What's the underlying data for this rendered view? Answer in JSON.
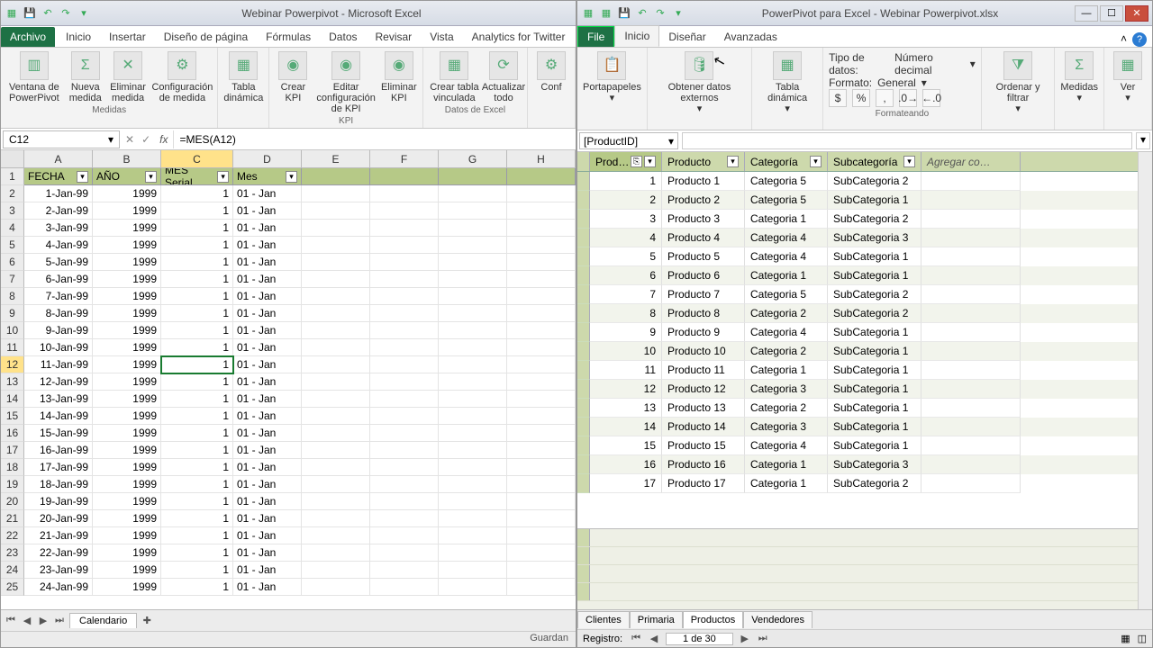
{
  "excel": {
    "title": "Webinar Powerpivot - Microsoft Excel",
    "tabs": {
      "file": "Archivo",
      "items": [
        "Inicio",
        "Insertar",
        "Diseño de página",
        "Fórmulas",
        "Datos",
        "Revisar",
        "Vista",
        "Analytics for Twitter"
      ]
    },
    "ribbon": {
      "g1": {
        "b1": "Ventana de\nPowerPivot",
        "b2": "Nueva\nmedida",
        "b3": "Eliminar\nmedida",
        "b4": "Configuración\nde medida",
        "label": "Medidas"
      },
      "g2": {
        "b1": "Tabla\ndinámica"
      },
      "g3": {
        "b1": "Crear\nKPI",
        "b2": "Editar configuración\nde KPI",
        "b3": "Eliminar\nKPI",
        "label": "KPI"
      },
      "g4": {
        "b1": "Crear tabla\nvinculada",
        "b2": "Actualizar\ntodo",
        "label": "Datos de Excel"
      },
      "g5": {
        "b1": "Conf"
      }
    },
    "namebox": "C12",
    "formula": "=MES(A12)",
    "cols": [
      "A",
      "B",
      "C",
      "D",
      "E",
      "F",
      "G",
      "H"
    ],
    "headers": {
      "A": "FECHA",
      "B": "AÑO",
      "C": "MES Serial",
      "D": "Mes"
    },
    "rows": [
      {
        "n": 1,
        "hdr": true
      },
      {
        "n": 2,
        "a": "1-Jan-99",
        "b": "1999",
        "c": "1",
        "d": "01 - Jan"
      },
      {
        "n": 3,
        "a": "2-Jan-99",
        "b": "1999",
        "c": "1",
        "d": "01 - Jan"
      },
      {
        "n": 4,
        "a": "3-Jan-99",
        "b": "1999",
        "c": "1",
        "d": "01 - Jan"
      },
      {
        "n": 5,
        "a": "4-Jan-99",
        "b": "1999",
        "c": "1",
        "d": "01 - Jan"
      },
      {
        "n": 6,
        "a": "5-Jan-99",
        "b": "1999",
        "c": "1",
        "d": "01 - Jan"
      },
      {
        "n": 7,
        "a": "6-Jan-99",
        "b": "1999",
        "c": "1",
        "d": "01 - Jan"
      },
      {
        "n": 8,
        "a": "7-Jan-99",
        "b": "1999",
        "c": "1",
        "d": "01 - Jan"
      },
      {
        "n": 9,
        "a": "8-Jan-99",
        "b": "1999",
        "c": "1",
        "d": "01 - Jan"
      },
      {
        "n": 10,
        "a": "9-Jan-99",
        "b": "1999",
        "c": "1",
        "d": "01 - Jan"
      },
      {
        "n": 11,
        "a": "10-Jan-99",
        "b": "1999",
        "c": "1",
        "d": "01 - Jan"
      },
      {
        "n": 12,
        "a": "11-Jan-99",
        "b": "1999",
        "c": "1",
        "d": "01 - Jan",
        "active": true
      },
      {
        "n": 13,
        "a": "12-Jan-99",
        "b": "1999",
        "c": "1",
        "d": "01 - Jan"
      },
      {
        "n": 14,
        "a": "13-Jan-99",
        "b": "1999",
        "c": "1",
        "d": "01 - Jan"
      },
      {
        "n": 15,
        "a": "14-Jan-99",
        "b": "1999",
        "c": "1",
        "d": "01 - Jan"
      },
      {
        "n": 16,
        "a": "15-Jan-99",
        "b": "1999",
        "c": "1",
        "d": "01 - Jan"
      },
      {
        "n": 17,
        "a": "16-Jan-99",
        "b": "1999",
        "c": "1",
        "d": "01 - Jan"
      },
      {
        "n": 18,
        "a": "17-Jan-99",
        "b": "1999",
        "c": "1",
        "d": "01 - Jan"
      },
      {
        "n": 19,
        "a": "18-Jan-99",
        "b": "1999",
        "c": "1",
        "d": "01 - Jan"
      },
      {
        "n": 20,
        "a": "19-Jan-99",
        "b": "1999",
        "c": "1",
        "d": "01 - Jan"
      },
      {
        "n": 21,
        "a": "20-Jan-99",
        "b": "1999",
        "c": "1",
        "d": "01 - Jan"
      },
      {
        "n": 22,
        "a": "21-Jan-99",
        "b": "1999",
        "c": "1",
        "d": "01 - Jan"
      },
      {
        "n": 23,
        "a": "22-Jan-99",
        "b": "1999",
        "c": "1",
        "d": "01 - Jan"
      },
      {
        "n": 24,
        "a": "23-Jan-99",
        "b": "1999",
        "c": "1",
        "d": "01 - Jan"
      },
      {
        "n": 25,
        "a": "24-Jan-99",
        "b": "1999",
        "c": "1",
        "d": "01 - Jan"
      }
    ],
    "sheet": "Calendario",
    "status": "Guardan"
  },
  "pp": {
    "title": "PowerPivot para Excel - Webinar Powerpivot.xlsx",
    "tabs": {
      "file": "File",
      "items": [
        "Inicio",
        "Diseñar",
        "Avanzadas"
      ]
    },
    "ribbon": {
      "g1": "Portapapeles",
      "g2": "Obtener datos\nexternos",
      "g3": "Tabla\ndinámica",
      "tipo_label": "Tipo de datos:",
      "tipo_val": "Número decimal",
      "fmt_label": "Formato:",
      "fmt_val": "General",
      "fmt_group": "Formateando",
      "g5": "Ordenar\ny filtrar",
      "g6": "Medidas",
      "g7": "Ver"
    },
    "namebox": "[ProductID]",
    "cols": [
      "Prod…",
      "Producto",
      "Categoría",
      "Subcategoría",
      "Agregar co…"
    ],
    "rows": [
      {
        "id": "1",
        "p": "Producto 1",
        "c": "Categoria 5",
        "s": "SubCategoria 2"
      },
      {
        "id": "2",
        "p": "Producto 2",
        "c": "Categoria 5",
        "s": "SubCategoria 1"
      },
      {
        "id": "3",
        "p": "Producto 3",
        "c": "Categoria 1",
        "s": "SubCategoria 2"
      },
      {
        "id": "4",
        "p": "Producto 4",
        "c": "Categoria 4",
        "s": "SubCategoria 3"
      },
      {
        "id": "5",
        "p": "Producto 5",
        "c": "Categoria 4",
        "s": "SubCategoria 1"
      },
      {
        "id": "6",
        "p": "Producto 6",
        "c": "Categoria 1",
        "s": "SubCategoria 1"
      },
      {
        "id": "7",
        "p": "Producto 7",
        "c": "Categoria 5",
        "s": "SubCategoria 2"
      },
      {
        "id": "8",
        "p": "Producto 8",
        "c": "Categoria 2",
        "s": "SubCategoria 2"
      },
      {
        "id": "9",
        "p": "Producto 9",
        "c": "Categoria 4",
        "s": "SubCategoria 1"
      },
      {
        "id": "10",
        "p": "Producto 10",
        "c": "Categoria 2",
        "s": "SubCategoria 1"
      },
      {
        "id": "11",
        "p": "Producto 11",
        "c": "Categoria 1",
        "s": "SubCategoria 1"
      },
      {
        "id": "12",
        "p": "Producto 12",
        "c": "Categoria 3",
        "s": "SubCategoria 1"
      },
      {
        "id": "13",
        "p": "Producto 13",
        "c": "Categoria 2",
        "s": "SubCategoria 1"
      },
      {
        "id": "14",
        "p": "Producto 14",
        "c": "Categoria 3",
        "s": "SubCategoria 1"
      },
      {
        "id": "15",
        "p": "Producto 15",
        "c": "Categoria 4",
        "s": "SubCategoria 1"
      },
      {
        "id": "16",
        "p": "Producto 16",
        "c": "Categoria 1",
        "s": "SubCategoria 3"
      },
      {
        "id": "17",
        "p": "Producto 17",
        "c": "Categoria 1",
        "s": "SubCategoria 2"
      }
    ],
    "sheets": [
      "Clientes",
      "Primaria",
      "Productos",
      "Vendedores"
    ],
    "active_sheet": 2,
    "status": {
      "label": "Registro:",
      "text": "1 de 30"
    }
  }
}
